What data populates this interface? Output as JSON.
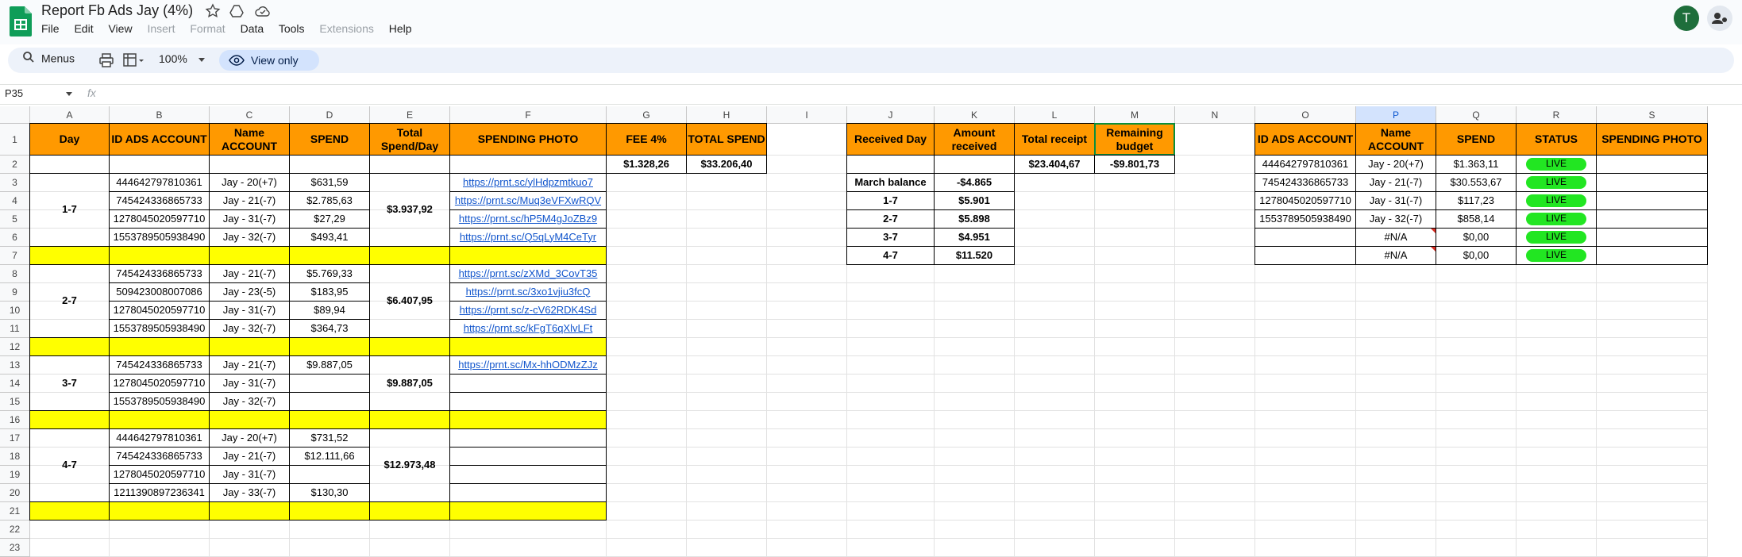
{
  "app": {
    "title": "Report Fb Ads Jay (4%)",
    "menu": [
      "File",
      "Edit",
      "View",
      "Insert",
      "Format",
      "Data",
      "Tools",
      "Extensions",
      "Help"
    ],
    "menu_disabled": [
      "Insert",
      "Format",
      "Extensions"
    ],
    "avatar_letter": "T"
  },
  "toolbar": {
    "menus_label": "Menus",
    "zoom": "100%",
    "view_only_label": "View only"
  },
  "formula_bar": {
    "cell_ref": "P35",
    "fx": "fx"
  },
  "sheet": {
    "columns": [
      "A",
      "B",
      "C",
      "D",
      "E",
      "F",
      "G",
      "H",
      "I",
      "J",
      "K",
      "L",
      "M",
      "N",
      "O",
      "P",
      "Q",
      "R",
      "S"
    ],
    "selected_column": "P",
    "rows": [
      1,
      2,
      3,
      4,
      5,
      6,
      7,
      8,
      9,
      10,
      11,
      12,
      13,
      14,
      15,
      16,
      17,
      18,
      19,
      20,
      21,
      22,
      23
    ],
    "left_table": {
      "headers": [
        "Day",
        "ID ADS ACCOUNT",
        "Name ACCOUNT",
        "SPEND",
        "Total Spend/Day",
        "SPENDING PHOTO",
        "FEE 4%",
        "TOTAL SPEND"
      ],
      "fee_total": "$1.328,26",
      "total_spend": "$33.206,40",
      "groups": [
        {
          "day": "1-7",
          "total": "$3.937,92",
          "rows": [
            {
              "id": "444642797810361",
              "name": "Jay - 20(+7)",
              "spend": "$631,59",
              "photo": "https://prnt.sc/ylHdpzmtkuo7"
            },
            {
              "id": "745424336865733",
              "name": "Jay - 21(-7)",
              "spend": "$2.785,63",
              "photo": "https://prnt.sc/Muq3eVFXwRQV"
            },
            {
              "id": "1278045020597710",
              "name": "Jay - 31(-7)",
              "spend": "$27,29",
              "photo": "https://prnt.sc/hP5M4gJoZBz9"
            },
            {
              "id": "1553789505938490",
              "name": "Jay - 32(-7)",
              "spend": "$493,41",
              "photo": "https://prnt.sc/Q5qLyM4CeTyr"
            }
          ]
        },
        {
          "day": "2-7",
          "total": "$6.407,95",
          "rows": [
            {
              "id": "745424336865733",
              "name": "Jay - 21(-7)",
              "spend": "$5.769,33",
              "photo": "https://prnt.sc/zXMd_3CovT35"
            },
            {
              "id": "509423008007086",
              "name": "Jay - 23(-5)",
              "spend": "$183,95",
              "photo": "https://prnt.sc/3xo1vjiu3fcQ"
            },
            {
              "id": "1278045020597710",
              "name": "Jay - 31(-7)",
              "spend": "$89,94",
              "photo": "https://prnt.sc/z-cV62RDK4Sd"
            },
            {
              "id": "1553789505938490",
              "name": "Jay - 32(-7)",
              "spend": "$364,73",
              "photo": "https://prnt.sc/kFgT6qXlvLFt"
            }
          ]
        },
        {
          "day": "3-7",
          "total": "$9.887,05",
          "rows": [
            {
              "id": "745424336865733",
              "name": "Jay - 21(-7)",
              "spend": "$9.887,05",
              "photo": "https://prnt.sc/Mx-hhODMzZJz"
            },
            {
              "id": "1278045020597710",
              "name": "Jay - 31(-7)",
              "spend": "",
              "photo": ""
            },
            {
              "id": "1553789505938490",
              "name": "Jay - 32(-7)",
              "spend": "",
              "photo": ""
            }
          ]
        },
        {
          "day": "4-7",
          "total": "$12.973,48",
          "rows": [
            {
              "id": "444642797810361",
              "name": "Jay - 20(+7)",
              "spend": "$731,52",
              "photo": ""
            },
            {
              "id": "745424336865733",
              "name": "Jay - 21(-7)",
              "spend": "$12.111,66",
              "photo": ""
            },
            {
              "id": "1278045020597710",
              "name": "Jay - 31(-7)",
              "spend": "",
              "photo": ""
            },
            {
              "id": "1211390897236341",
              "name": "Jay - 33(-7)",
              "spend": "$130,30",
              "photo": ""
            }
          ]
        }
      ]
    },
    "received_table": {
      "headers": [
        "Received Day",
        "Amount received",
        "Total receipt",
        "Remaining budget"
      ],
      "total_receipt": "$23.404,67",
      "remaining_budget": "-$9.801,73",
      "rows": [
        {
          "day": "March balance",
          "amount": "-$4.865"
        },
        {
          "day": "1-7",
          "amount": "$5.901"
        },
        {
          "day": "2-7",
          "amount": "$5.898"
        },
        {
          "day": "3-7",
          "amount": "$4.951"
        },
        {
          "day": "4-7",
          "amount": "$11.520"
        }
      ]
    },
    "status_table": {
      "headers": [
        "ID ADS ACCOUNT",
        "Name ACCOUNT",
        "SPEND",
        "STATUS",
        "SPENDING PHOTO"
      ],
      "rows": [
        {
          "id": "444642797810361",
          "name": "Jay - 20(+7)",
          "spend": "$1.363,11",
          "status": "LIVE",
          "photo": ""
        },
        {
          "id": "745424336865733",
          "name": "Jay - 21(-7)",
          "spend": "$30.553,67",
          "status": "LIVE",
          "photo": ""
        },
        {
          "id": "1278045020597710",
          "name": "Jay - 31(-7)",
          "spend": "$117,23",
          "status": "LIVE",
          "photo": ""
        },
        {
          "id": "1553789505938490",
          "name": "Jay - 32(-7)",
          "spend": "$858,14",
          "status": "LIVE",
          "photo": ""
        },
        {
          "id": "",
          "name": "#N/A",
          "spend": "$0,00",
          "status": "LIVE",
          "photo": "",
          "error": true
        },
        {
          "id": "",
          "name": "#N/A",
          "spend": "$0,00",
          "status": "LIVE",
          "photo": "",
          "error": true
        }
      ]
    }
  },
  "colors": {
    "header_orange": "#ff9900",
    "separator_yellow": "#ffff00",
    "live_green": "#22e622",
    "sheets_green": "#0f9d58"
  }
}
